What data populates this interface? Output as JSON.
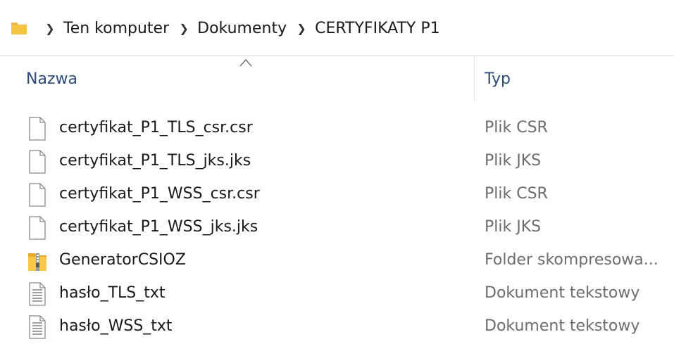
{
  "breadcrumb": {
    "items": [
      "Ten komputer",
      "Dokumenty",
      "CERTYFIKATY P1"
    ]
  },
  "columns": {
    "name": "Nazwa",
    "type": "Typ"
  },
  "files": [
    {
      "name": "certyfikat_P1_TLS_csr.csr",
      "type": "Plik CSR",
      "icon": "generic-file-icon"
    },
    {
      "name": "certyfikat_P1_TLS_jks.jks",
      "type": "Plik JKS",
      "icon": "generic-file-icon"
    },
    {
      "name": "certyfikat_P1_WSS_csr.csr",
      "type": "Plik CSR",
      "icon": "generic-file-icon"
    },
    {
      "name": "certyfikat_P1_WSS_jks.jks",
      "type": "Plik JKS",
      "icon": "generic-file-icon"
    },
    {
      "name": "GeneratorCSIOZ",
      "type": "Folder skompresowa...",
      "icon": "zip-folder-icon"
    },
    {
      "name": "hasło_TLS_txt",
      "type": "Dokument tekstowy",
      "icon": "text-file-icon"
    },
    {
      "name": "hasło_WSS_txt",
      "type": "Dokument tekstowy",
      "icon": "text-file-icon"
    }
  ],
  "colors": {
    "header_text": "#2c4b7b",
    "type_text": "#6d6d6d",
    "folder_yellow": "#f5c542"
  }
}
